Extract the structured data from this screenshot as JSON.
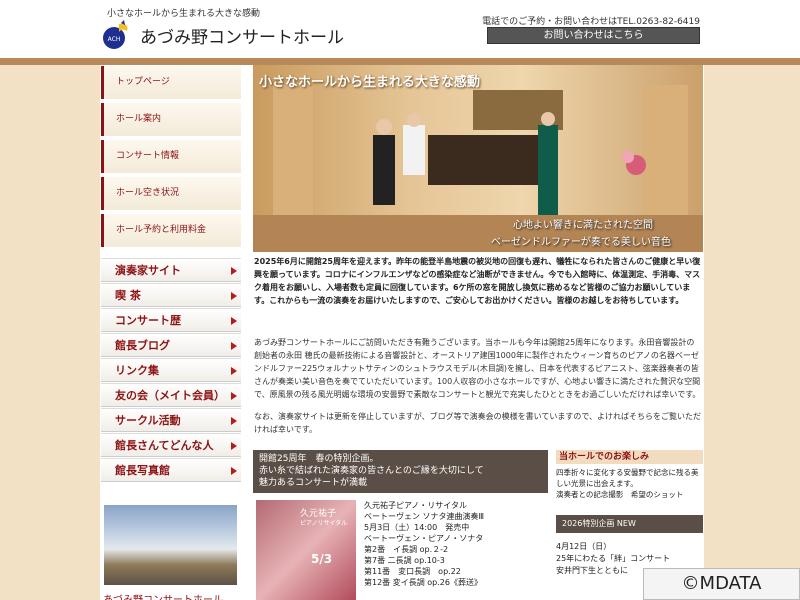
{
  "header": {
    "tagline": "小さなホールから生まれる大きな感動",
    "site_name": "あづみ野コンサートホール",
    "logo_text": "ACH",
    "tel": "電話でのご予約・お問い合わせはTEL.0263-82-6419",
    "contact_button": "お問い合わせはこちら"
  },
  "nav": {
    "items": [
      {
        "label": "トップページ"
      },
      {
        "label": "ホール案内"
      },
      {
        "label": "コンサート情報"
      },
      {
        "label": "ホール空き状況"
      },
      {
        "label": "ホール予約と利用料金"
      }
    ]
  },
  "links": {
    "items": [
      {
        "label": "演奏家サイト"
      },
      {
        "label": "喫 茶"
      },
      {
        "label": "コンサート歴"
      },
      {
        "label": "館長ブログ"
      },
      {
        "label": "リンク集"
      },
      {
        "label": "友の会（メイト会員）"
      },
      {
        "label": "サークル活動"
      },
      {
        "label": "館長さんてどんな人"
      },
      {
        "label": "館長写真館"
      }
    ]
  },
  "left_photo_caption": "あづみ野コンサートホール",
  "hero": {
    "title": "小さなホールから生まれる大きな感動",
    "caption1": "心地よい響きに満たされた空間",
    "caption2": "ベーゼンドルファーが奏でる美しい音色"
  },
  "main": {
    "para1": "2025年6月に開館25周年を迎えます。昨年の能登半島地震の被災地の回復も遅れ、犠牲になられた皆さんのご健康と早い復興を願っています。コロナにインフルエンザなどの感染症など油断ができません。今でも入館時に、体温測定、手消毒、マスク着用をお願いし、入場者数も定員に回復しています。6ケ所の窓を開放し換気に務めるなど皆様のご協力お願いしています。これからも一流の演奏をお届けいたしますので、ご安心してお出かけください。皆様のお越しをお待ちしています。",
    "para2": "あづみ野コンサートホールにご訪問いただき有難うございます。当ホールも今年は開館25周年になります。永田音響設計の創始者の永田 穂氏の最新技術による音響設計と、オーストリア建国1000年に製作されたウィーン育ちのピアノの名器ベーゼンドルファー225ウォルナットサティンのシュトラウスモデル(木目調)を擁し、日本を代表するピアニスト、弦楽器奏者の皆さんが奏楽い美い音色を奏でていただいています。100人収容の小さなホールですが、心地よい響きに満たされた贅沢な空間で、原風景の残る風光明媚な環境の安曇野で素敵なコンサートと観光で充実したひとときをお過ごしいただければ幸いです。",
    "para3": "なお、演奏家サイトは更新を停止していますが、ブログ等で演奏会の模様を書いていますので、よければそちらをご覧いただければ幸いです。"
  },
  "feature": {
    "line1": "開館25周年　春の特別企画。",
    "line2": "赤い糸で結ばれた演奏家の皆さんとのご縁を大切にして",
    "line3": "魅力あるコンサートが満載"
  },
  "event": {
    "img_name": "久元祐子",
    "img_sub": "ピアノリサイタル",
    "img_date": "5/3",
    "lines": [
      "久元祐子ピアノ・リサイタル",
      "ベートーヴェン ソナタ連曲演奏Ⅲ",
      "5月3日（土）14:00　発売中",
      "ベートーヴェン・ピアノ・ソナタ",
      "第2番　イ長調 op.２-2",
      "第7番 二長調 op.10-3",
      "第11番　変口長調　op.22",
      "第12番 変イ長調 op.26《葬送》"
    ]
  },
  "right_col": {
    "head1": "当ホールでのお楽しみ",
    "text1": "四季折々に変化する安曇野で記念に残る美しい光景に出会えます。",
    "text1b": "演奏者との記念撮影　希望のショット",
    "head2": "2026特別企画 NEW",
    "text2a": "4月12日（日）",
    "text2b": "25年にわたる「絆」コンサート",
    "text2c": "安井門下生とともに"
  },
  "watermark": "©MDATA"
}
